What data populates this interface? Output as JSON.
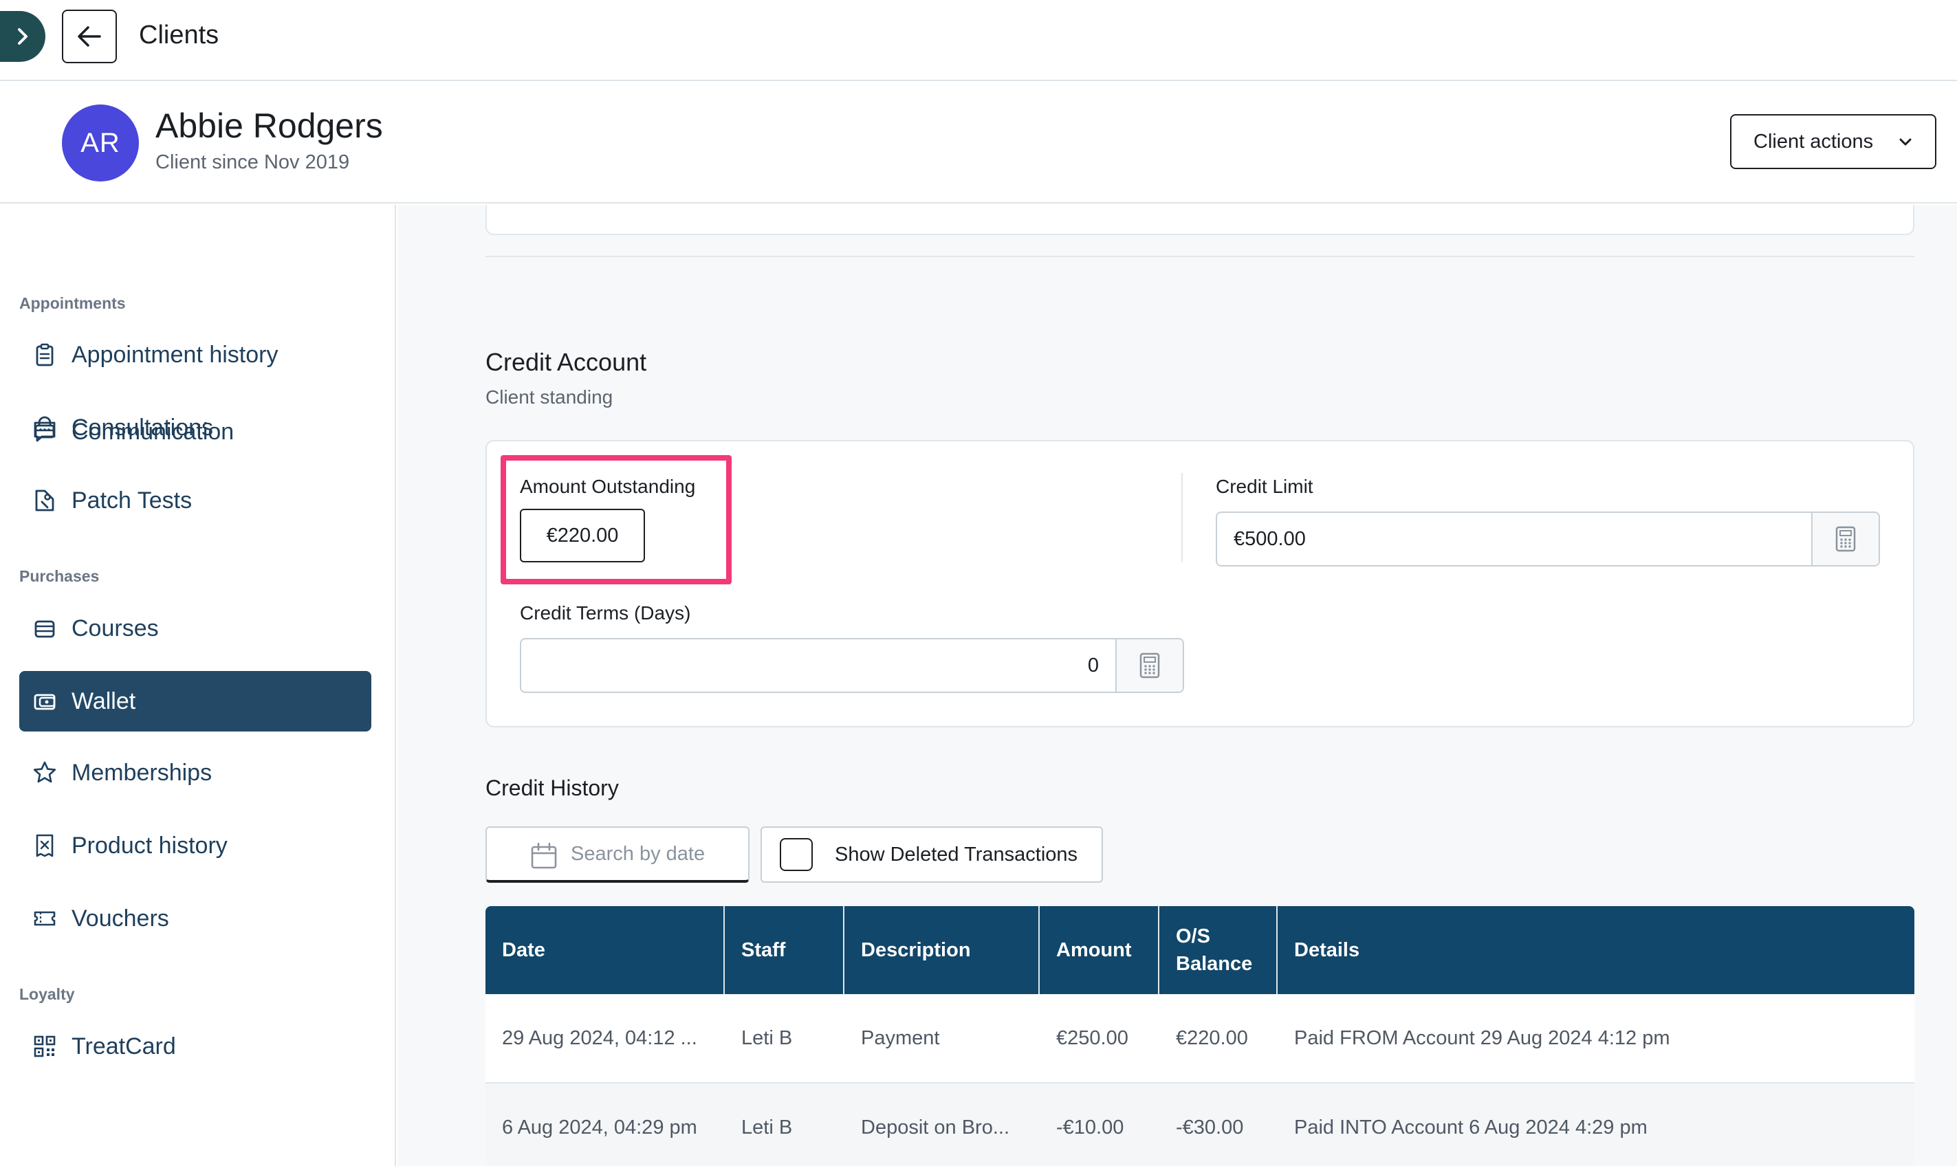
{
  "topbar": {
    "title": "Clients"
  },
  "client": {
    "initials": "AR",
    "name": "Abbie Rodgers",
    "since": "Client since Nov 2019",
    "actions_label": "Client actions"
  },
  "sidebar": {
    "communication": "Communication",
    "sections": {
      "appointments": "Appointments",
      "purchases": "Purchases",
      "loyalty": "Loyalty"
    },
    "appointments": [
      "Appointment history",
      "Consultations",
      "Patch Tests"
    ],
    "purchases": [
      "Courses",
      "Wallet",
      "Memberships",
      "Product history",
      "Vouchers"
    ],
    "loyalty": [
      "TreatCard"
    ],
    "active": "Wallet"
  },
  "credit_account": {
    "title": "Credit Account",
    "subtitle": "Client standing",
    "amount_outstanding_label": "Amount Outstanding",
    "amount_outstanding_value": "€220.00",
    "credit_limit_label": "Credit Limit",
    "credit_limit_value": "€500.00",
    "credit_terms_label": "Credit Terms (Days)",
    "credit_terms_value": "0"
  },
  "credit_history": {
    "title": "Credit History",
    "search_placeholder": "Search by date",
    "show_deleted_label": "Show Deleted Transactions",
    "show_deleted_checked": false,
    "columns": [
      "Date",
      "Staff",
      "Description",
      "Amount",
      "O/S Balance",
      "Details"
    ],
    "rows": [
      [
        "29 Aug 2024, 04:12 ...",
        "Leti B",
        "Payment",
        "€250.00",
        "€220.00",
        "Paid FROM Account 29 Aug 2024 4:12 pm"
      ],
      [
        "6 Aug 2024, 04:29 pm",
        "Leti B",
        "Deposit on Bro...",
        "-€10.00",
        "-€30.00",
        "Paid INTO Account 6 Aug 2024 4:29 pm"
      ]
    ]
  },
  "colors": {
    "brand_dark": "#11476a",
    "nav_active": "#234966",
    "avatar": "#4a47dc",
    "highlight": "#f23a78"
  }
}
